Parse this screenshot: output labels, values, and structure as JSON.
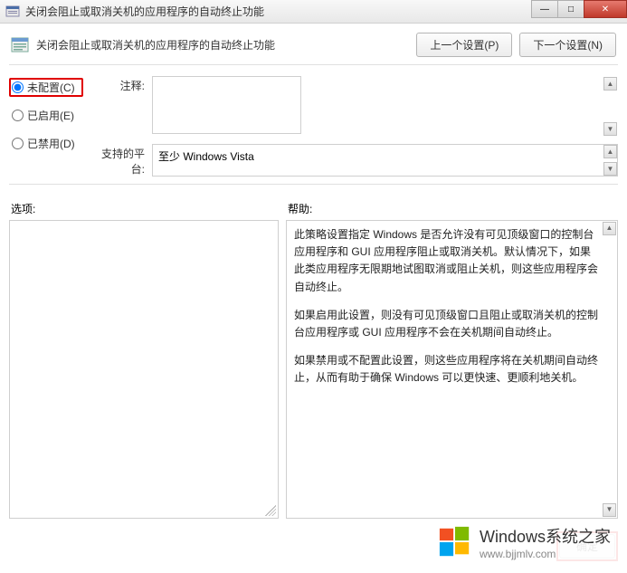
{
  "titlebar": {
    "title": "关闭会阻止或取消关机的应用程序的自动终止功能"
  },
  "header": {
    "title": "关闭会阻止或取消关机的应用程序的自动终止功能",
    "prev_btn": "上一个设置(P)",
    "next_btn": "下一个设置(N)"
  },
  "radios": {
    "not_configured": "未配置(C)",
    "enabled": "已启用(E)",
    "disabled": "已禁用(D)",
    "selected": "not_configured"
  },
  "labels": {
    "comment": "注释:",
    "platform": "支持的平台:",
    "options": "选项:",
    "help": "帮助:"
  },
  "comment_value": "",
  "platform_value": "至少 Windows Vista",
  "help_paragraphs": [
    "此策略设置指定 Windows 是否允许没有可见顶级窗口的控制台应用程序和 GUI 应用程序阻止或取消关机。默认情况下，如果此类应用程序无限期地试图取消或阻止关机，则这些应用程序会自动终止。",
    "如果启用此设置，则没有可见顶级窗口且阻止或取消关机的控制台应用程序或 GUI 应用程序不会在关机期间自动终止。",
    "如果禁用或不配置此设置，则这些应用程序将在关机期间自动终止，从而有助于确保 Windows 可以更快速、更顺利地关机。"
  ],
  "footer": {
    "ok": "确定"
  },
  "watermark": {
    "line1": "Windows系统之家",
    "line2": "www.bjjmlv.com"
  }
}
